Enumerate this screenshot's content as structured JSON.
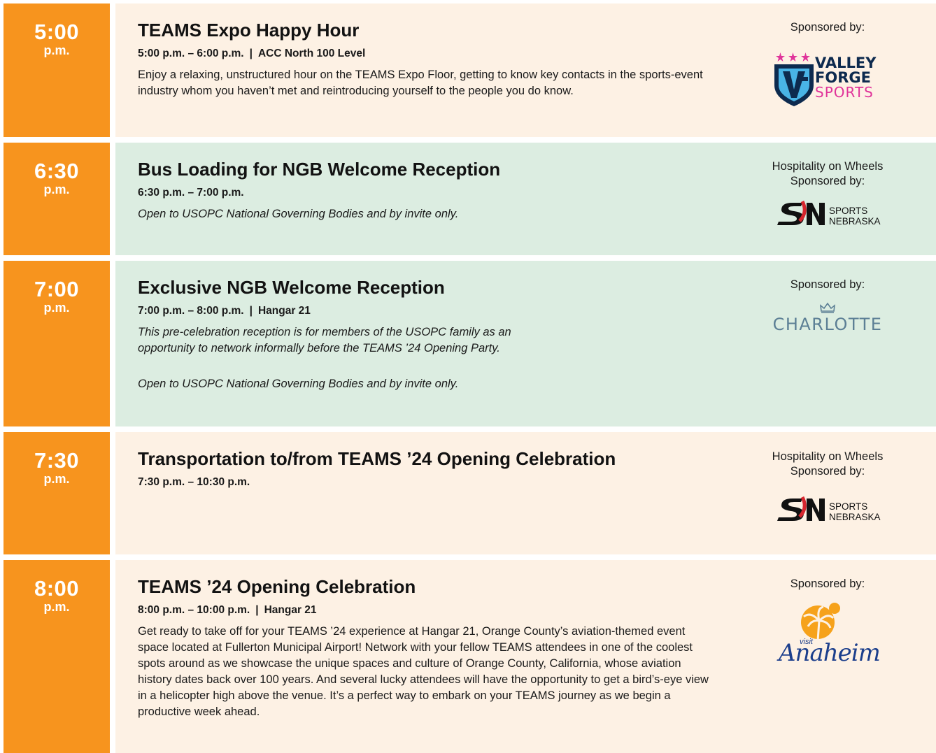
{
  "events": [
    {
      "time": "5:00",
      "ampm": "p.m.",
      "title": "TEAMS Expo Happy Hour",
      "hours": "5:00 p.m. – 6:00 p.m.",
      "location": "ACC North 100 Level",
      "description": "Enjoy a relaxing, unstructured hour on the TEAMS Expo Floor, getting to know key contacts in the sports-event industry whom you haven’t met and reintroducing yourself to the people you do know.",
      "sponsor_label": "Sponsored by:",
      "sponsor_logo": {
        "line1": "VALLEY",
        "line2": "FORGE",
        "line3": "SPORTS",
        "mark": "VF"
      }
    },
    {
      "time": "6:30",
      "ampm": "p.m.",
      "title": "Bus Loading for NGB Welcome Reception",
      "hours": "6:30 p.m. – 7:00 p.m.",
      "note": "Open to USOPC National Governing Bodies and by invite only.",
      "sponsor_label_1": "Hospitality on Wheels",
      "sponsor_label_2": "Sponsored by:",
      "sponsor_logo": {
        "line1": "SPORTS",
        "line2": "NEBRASKA"
      }
    },
    {
      "time": "7:00",
      "ampm": "p.m.",
      "title": "Exclusive NGB Welcome Reception",
      "hours": "7:00 p.m. – 8:00 p.m.",
      "location": "Hangar 21",
      "description": "This pre-celebration reception is for members of the USOPC family as an opportunity to network informally before the TEAMS ’24 Opening Party.",
      "note": "Open to USOPC National Governing Bodies and by invite only.",
      "sponsor_label": "Sponsored by:",
      "sponsor_logo": {
        "text": "CHARLOTTE"
      }
    },
    {
      "time": "7:30",
      "ampm": "p.m.",
      "title": "Transportation to/from TEAMS ’24 Opening Celebration",
      "hours": "7:30 p.m. – 10:30 p.m.",
      "sponsor_label_1": "Hospitality on Wheels",
      "sponsor_label_2": "Sponsored by:",
      "sponsor_logo": {
        "line1": "SPORTS",
        "line2": "NEBRASKA"
      }
    },
    {
      "time": "8:00",
      "ampm": "p.m.",
      "title": "TEAMS ’24 Opening Celebration",
      "hours": "8:00 p.m. – 10:00 p.m.",
      "location": "Hangar 21",
      "description": "Get ready to take off for your TEAMS ’24 experience at Hangar 21, Orange County’s aviation-themed event space located at Fullerton Municipal Airport! Network with your fellow TEAMS attendees in one of the coolest spots around as we showcase the unique spaces and culture of Orange County, California, whose aviation history dates back over 100 years. And several lucky attendees will have the opportunity to get a bird’s-eye view in a helicopter high above the venue. It’s a perfect way to embark on your TEAMS journey as we begin a productive week ahead.",
      "sponsor_label": "Sponsored by:",
      "sponsor_logo": {
        "small": "visit",
        "big": "Anaheim"
      }
    }
  ],
  "colors": {
    "orange": "#f7941e",
    "peach": "#fdf1e4",
    "mint": "#dcede1",
    "vf_blue": "#0d2a4e",
    "vf_pink": "#e0349a",
    "sn_red": "#d7262e",
    "charlotte": "#5c7f95",
    "anaheim_blue": "#1c3f8c",
    "anaheim_orange": "#f6a21b"
  }
}
